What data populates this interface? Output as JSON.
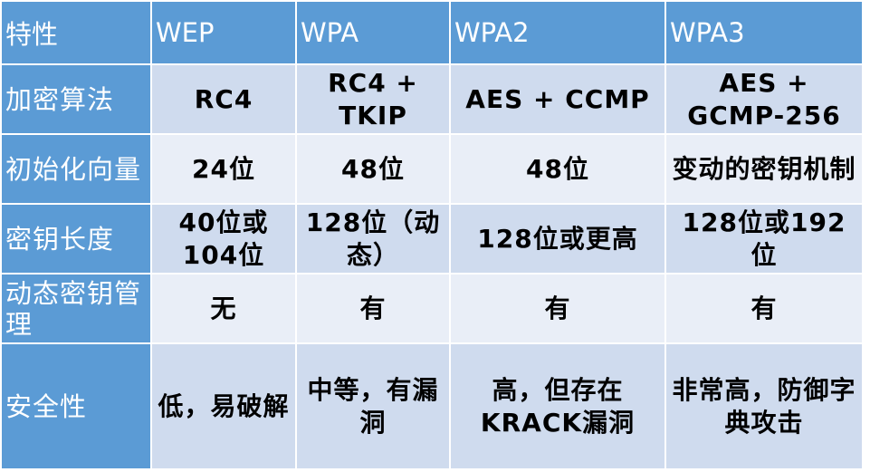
{
  "table": {
    "headers": [
      "特性",
      "WEP",
      "WPA",
      "WPA2",
      "WPA3"
    ],
    "rows": [
      {
        "label": "加密算法",
        "cells": [
          "RC4",
          "RC4 + TKIP",
          "AES + CCMP",
          "AES + GCMP-256"
        ]
      },
      {
        "label": "初始化向量",
        "cells": [
          "24位",
          "48位",
          "48位",
          "变动的密钥机制"
        ]
      },
      {
        "label": "密钥长度",
        "cells": [
          "40位或104位",
          "128位（动态）",
          "128位或更高",
          "128位或192位"
        ]
      },
      {
        "label": "动态密钥管理",
        "cells": [
          "无",
          "有",
          "有",
          "有"
        ]
      },
      {
        "label": "安全性",
        "cells": [
          "低，易破解",
          "中等，有漏洞",
          "高，但存在KRACK漏洞",
          "非常高，防御字典攻击"
        ]
      }
    ]
  },
  "colors": {
    "header_bg": "#5b9bd5",
    "row_dark": "#cfdbee",
    "row_light": "#e9eef7"
  }
}
